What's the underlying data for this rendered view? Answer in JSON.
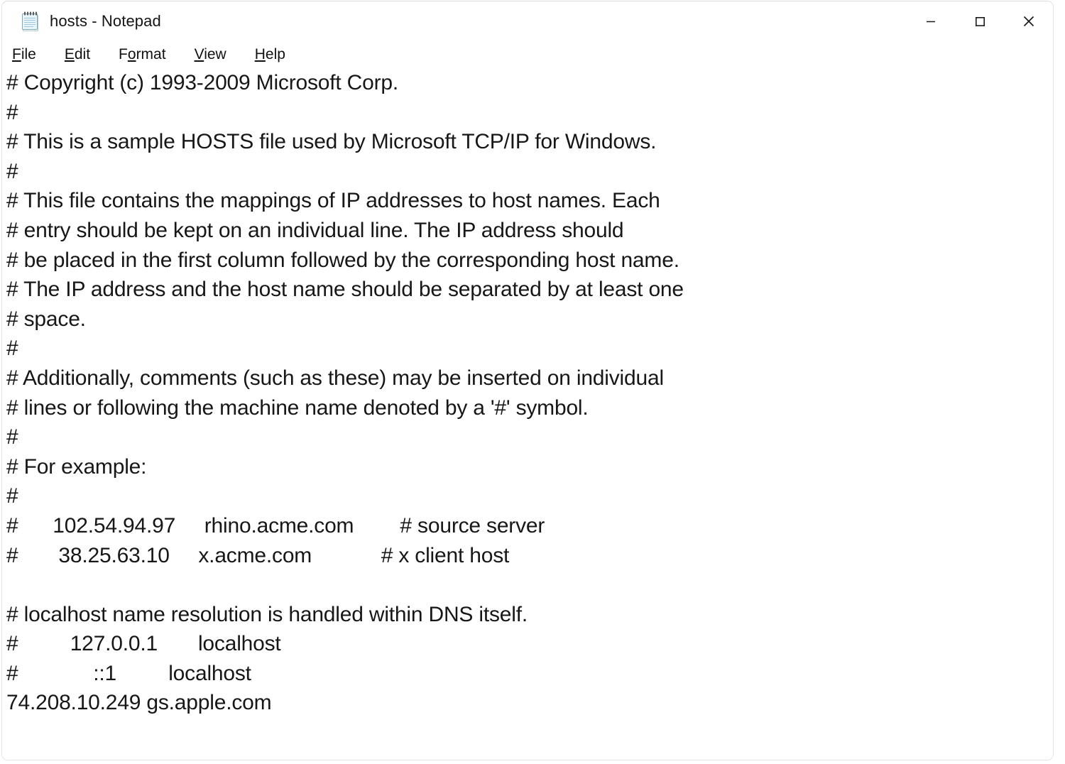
{
  "window": {
    "title": "hosts - Notepad",
    "app_icon": "notepad-icon",
    "background_color": "#ffffff",
    "text_color": "#171717",
    "border_color": "#e3e3e3"
  },
  "titlebar": {
    "controls": [
      {
        "name": "minimize",
        "label": "Minimize",
        "glyph": "minimize-icon"
      },
      {
        "name": "maximize",
        "label": "Maximize",
        "glyph": "maximize-icon"
      },
      {
        "name": "close",
        "label": "Close",
        "glyph": "close-icon"
      }
    ]
  },
  "menubar": {
    "items": [
      {
        "label": "File",
        "pre": "",
        "mnemonic": "F",
        "post": "ile"
      },
      {
        "label": "Edit",
        "pre": "",
        "mnemonic": "E",
        "post": "dit"
      },
      {
        "label": "Format",
        "pre": "F",
        "mnemonic": "o",
        "post": "rmat"
      },
      {
        "label": "View",
        "pre": "",
        "mnemonic": "V",
        "post": "iew"
      },
      {
        "label": "Help",
        "pre": "",
        "mnemonic": "H",
        "post": "elp"
      }
    ]
  },
  "document": {
    "filename": "hosts",
    "lines": [
      "# Copyright (c) 1993-2009 Microsoft Corp.",
      "#",
      "# This is a sample HOSTS file used by Microsoft TCP/IP for Windows.",
      "#",
      "# This file contains the mappings of IP addresses to host names. Each",
      "# entry should be kept on an individual line. The IP address should",
      "# be placed in the first column followed by the corresponding host name.",
      "# The IP address and the host name should be separated by at least one",
      "# space.",
      "#",
      "# Additionally, comments (such as these) may be inserted on individual",
      "# lines or following the machine name denoted by a '#' symbol.",
      "#",
      "# For example:",
      "#",
      "#      102.54.94.97     rhino.acme.com        # source server",
      "#       38.25.63.10     x.acme.com            # x client host",
      "",
      "# localhost name resolution is handled within DNS itself.",
      "#         127.0.0.1       localhost",
      "#             ::1         localhost",
      "74.208.10.249 gs.apple.com"
    ]
  }
}
